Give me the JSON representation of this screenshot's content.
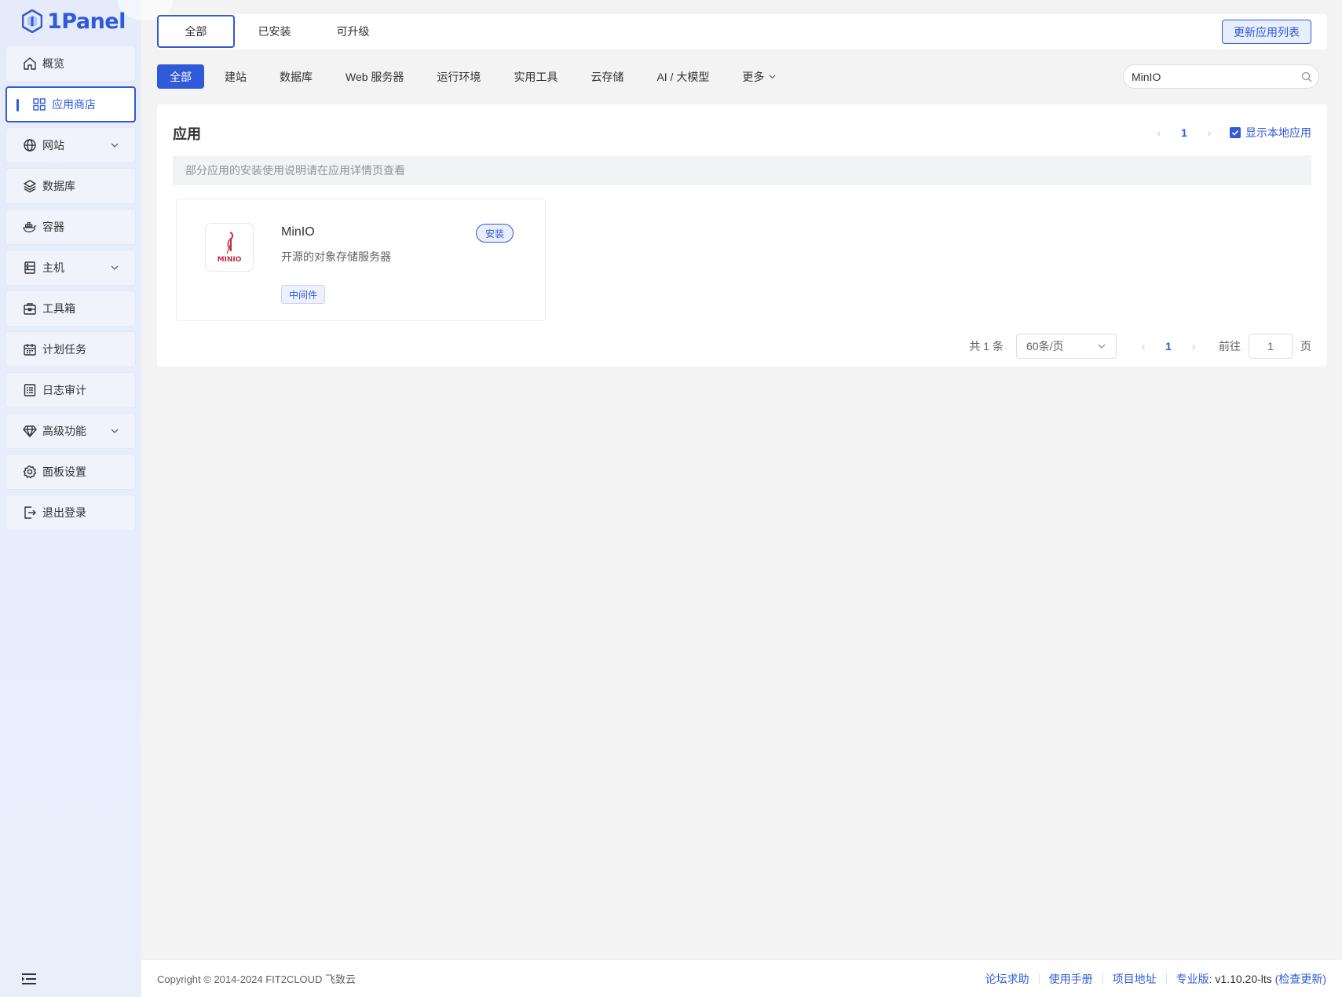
{
  "brand": {
    "name": "1Panel"
  },
  "sidebar": {
    "items": [
      {
        "label": "概览",
        "icon": "home-icon"
      },
      {
        "label": "应用商店",
        "icon": "grid-icon",
        "active": true
      },
      {
        "label": "网站",
        "icon": "globe-icon",
        "expandable": true
      },
      {
        "label": "数据库",
        "icon": "layers-icon"
      },
      {
        "label": "容器",
        "icon": "docker-icon"
      },
      {
        "label": "主机",
        "icon": "server-icon",
        "expandable": true
      },
      {
        "label": "工具箱",
        "icon": "toolbox-icon"
      },
      {
        "label": "计划任务",
        "icon": "calendar-icon"
      },
      {
        "label": "日志审计",
        "icon": "log-icon"
      },
      {
        "label": "高级功能",
        "icon": "diamond-icon",
        "expandable": true
      },
      {
        "label": "面板设置",
        "icon": "gear-icon"
      },
      {
        "label": "退出登录",
        "icon": "logout-icon"
      }
    ]
  },
  "top_tabs": [
    "全部",
    "已安装",
    "可升级"
  ],
  "update_button": "更新应用列表",
  "categories": [
    "全部",
    "建站",
    "数据库",
    "Web 服务器",
    "运行环境",
    "实用工具",
    "云存储",
    "AI / 大模型",
    "更多"
  ],
  "search": {
    "value": "MinIO"
  },
  "main": {
    "title": "应用",
    "page": "1",
    "show_local": "显示本地应用",
    "notice": "部分应用的安装使用说明请在应用详情页查看",
    "app": {
      "name": "MinIO",
      "desc": "开源的对象存储服务器",
      "install_label": "安装",
      "tag": "中间件",
      "logo_text": "MINIO"
    },
    "pager": {
      "total": "共 1 条",
      "page_size": "60条/页",
      "current": "1",
      "goto_label": "前往",
      "goto_value": "1",
      "page_unit": "页"
    }
  },
  "footer": {
    "copyright": "Copyright © 2014-2024 FIT2CLOUD 飞致云",
    "links": [
      "论坛求助",
      "使用手册",
      "项目地址"
    ],
    "edition": "专业版:",
    "version": "v1.10.20-lts",
    "check_update": "(检查更新)"
  },
  "colors": {
    "accent": "#2f5ad8",
    "brand_red": "#c72c48"
  }
}
